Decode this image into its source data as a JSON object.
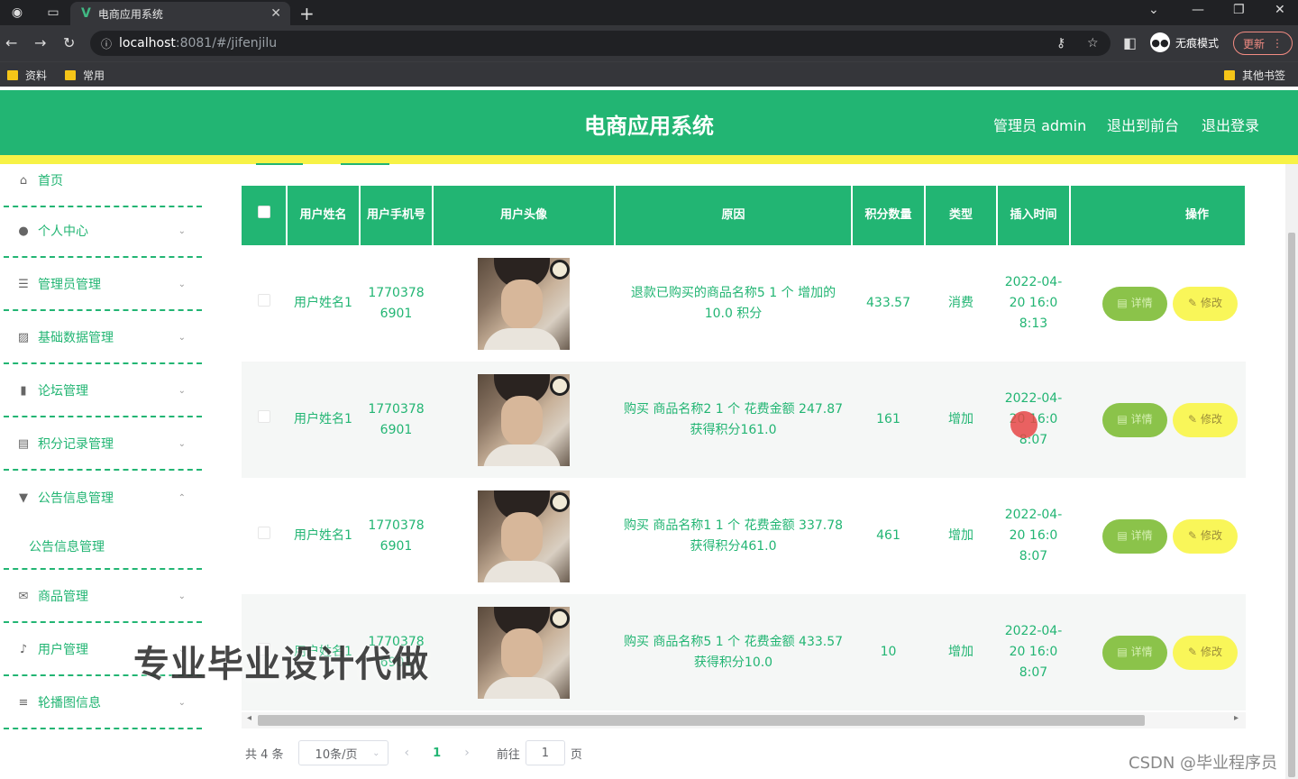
{
  "browser": {
    "tab_title": "电商应用系统",
    "url_host": "localhost",
    "url_rest": ":8081/#/jifenjilu",
    "incognito_label": "无痕模式",
    "update_label": "更新",
    "bookmarks": [
      "资料",
      "常用"
    ],
    "other_bookmarks": "其他书签"
  },
  "header": {
    "title": "电商应用系统",
    "admin": "管理员 admin",
    "back_front": "退出到前台",
    "logout": "退出登录"
  },
  "sidebar": {
    "items": [
      {
        "label": "首页",
        "icon": "home-icon"
      },
      {
        "label": "个人中心",
        "icon": "user-icon"
      },
      {
        "label": "管理员管理",
        "icon": "sliders-icon"
      },
      {
        "label": "基础数据管理",
        "icon": "chart-icon"
      },
      {
        "label": "论坛管理",
        "icon": "bar-chart-icon"
      },
      {
        "label": "积分记录管理",
        "icon": "document-icon"
      },
      {
        "label": "公告信息管理",
        "icon": "bell-icon"
      },
      {
        "label": "商品管理",
        "icon": "mail-icon"
      },
      {
        "label": "用户管理",
        "icon": "mic-icon"
      },
      {
        "label": "轮播图信息",
        "icon": "list-icon"
      }
    ],
    "sub_item": "公告信息管理"
  },
  "table": {
    "headers": [
      "用户姓名",
      "用户手机号",
      "用户头像",
      "原因",
      "积分数量",
      "类型",
      "插入时间",
      "操作"
    ],
    "rows": [
      {
        "name": "用户姓名1",
        "phone": "17703786901",
        "reason": "退款已购买的商品名称5 1 个 增加的 10.0 积分",
        "points": "433.57",
        "type": "消费",
        "time": "2022-04-20 16:08:13"
      },
      {
        "name": "用户姓名1",
        "phone": "17703786901",
        "reason": "购买 商品名称2 1 个 花费金额 247.87 获得积分161.0",
        "points": "161",
        "type": "增加",
        "time": "2022-04-20 16:08:07"
      },
      {
        "name": "用户姓名1",
        "phone": "17703786901",
        "reason": "购买 商品名称1 1 个 花费金额 337.78 获得积分461.0",
        "points": "461",
        "type": "增加",
        "time": "2022-04-20 16:08:07"
      },
      {
        "name": "用户姓名1",
        "phone": "17703786901",
        "reason": "购买 商品名称5 1 个 花费金额 433.57 获得积分10.0",
        "points": "10",
        "type": "增加",
        "time": "2022-04-20 16:08:07"
      }
    ],
    "detail_label": "详情",
    "edit_label": "修改"
  },
  "pagination": {
    "total": "共 4 条",
    "page_size": "10条/页",
    "current": "1",
    "goto_prefix": "前往",
    "goto_value": "1",
    "goto_suffix": "页"
  },
  "overlay": {
    "watermark": "专业毕业设计代做",
    "credit": "CSDN @毕业程序员"
  },
  "colors": {
    "primary": "#22b573",
    "accent": "#f7f246",
    "detail_button": "#8bc34a",
    "edit_button": "#f9f659"
  }
}
